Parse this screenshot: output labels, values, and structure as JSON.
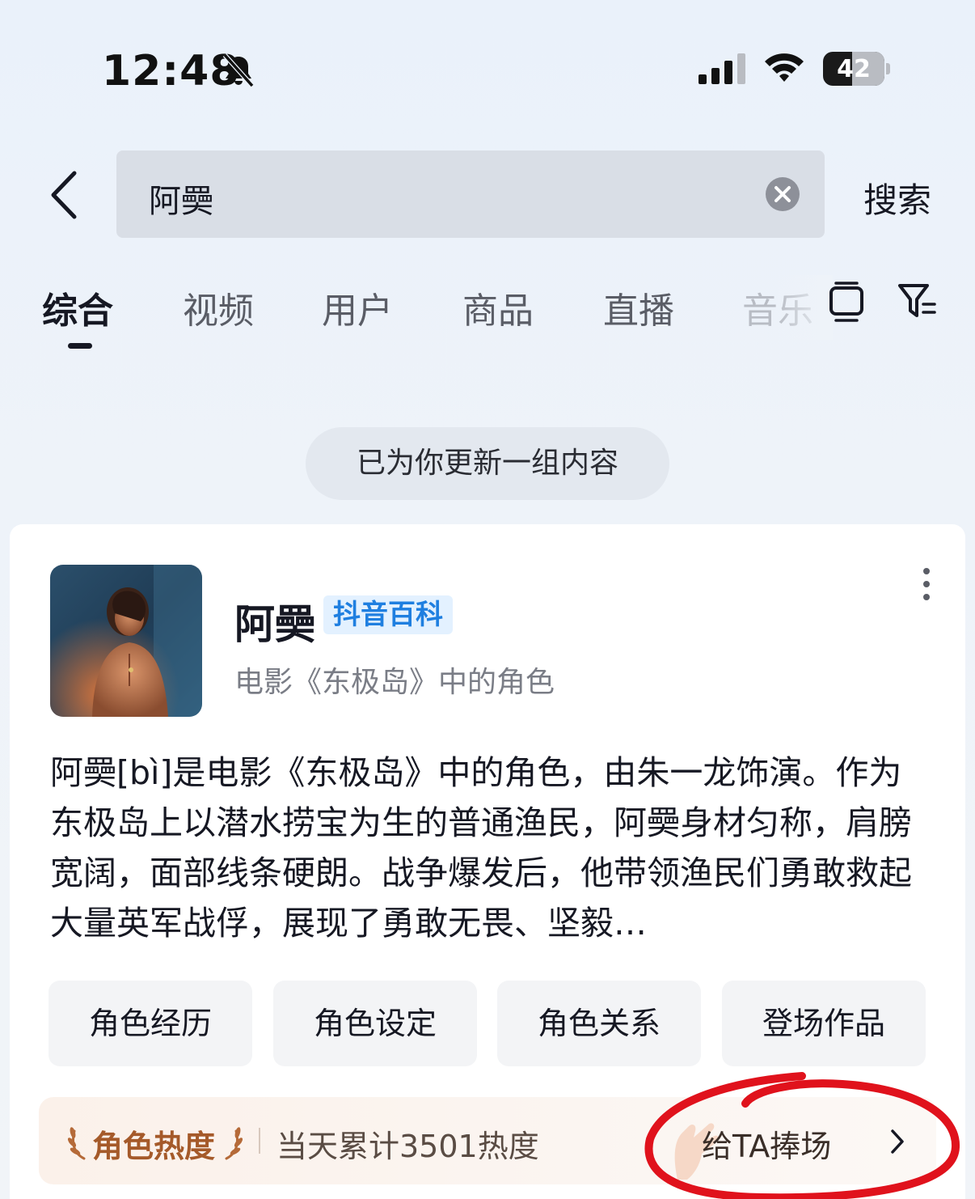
{
  "status_bar": {
    "time": "12:48",
    "battery": "42",
    "icons": [
      "bell-muted-icon",
      "cellular-signal-icon",
      "wifi-icon",
      "battery-icon"
    ]
  },
  "search": {
    "query": "阿奰",
    "submit_label": "搜索",
    "icons": [
      "back-icon",
      "clear-icon"
    ]
  },
  "tabs": {
    "items": [
      "综合",
      "视频",
      "用户",
      "商品",
      "直播",
      "音乐"
    ],
    "active": "综合",
    "icons": [
      "view-mode-icon",
      "filter-icon"
    ]
  },
  "toast": "已为你更新一组内容",
  "result_card": {
    "name": "阿奰",
    "badge": "抖音百科",
    "subtitle": "电影《东极岛》中的角色",
    "description": "阿奰[bì]是电影《东极岛》中的角色，由朱一龙饰演。作为东极岛上以潜水捞宝为生的普通渔民，阿奰身材匀称，肩膀宽阔，面部线条硬朗。战争爆发后，他带领渔民们勇敢救起大量英军战俘，展现了勇敢无畏、坚毅…",
    "chips": [
      "角色经历",
      "角色设定",
      "角色关系",
      "登场作品"
    ],
    "heat": {
      "label": "角色热度",
      "stat": "当天累计3501热度",
      "action": "给TA捧场"
    },
    "icons": [
      "more-icon",
      "laurel-icon",
      "chevron-right-icon"
    ]
  },
  "colors": {
    "badge_text": "#1f7fe0",
    "heat_label": "#a55a2a",
    "annotation": "#e0121c"
  }
}
